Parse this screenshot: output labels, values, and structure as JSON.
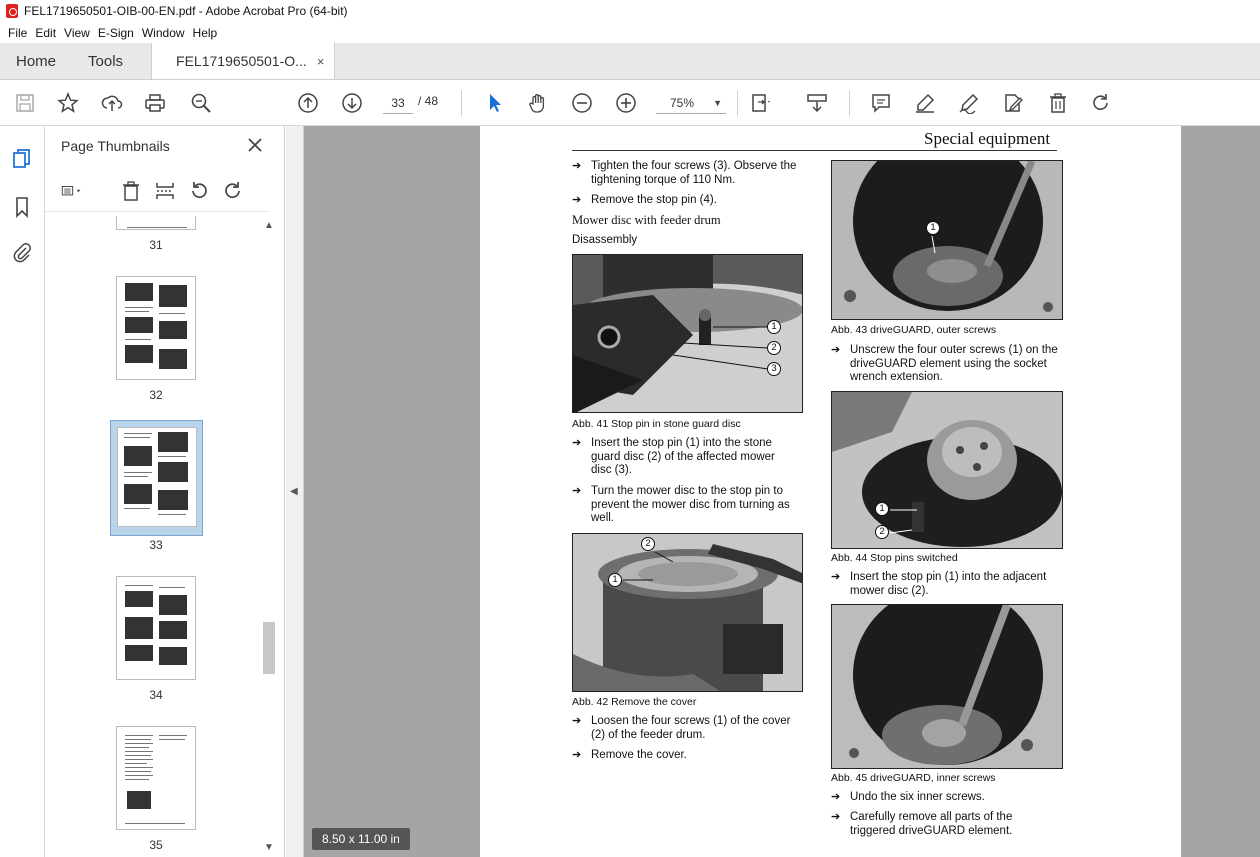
{
  "window": {
    "title": "FEL1719650501-OIB-00-EN.pdf - Adobe Acrobat Pro (64-bit)"
  },
  "menu": [
    "File",
    "Edit",
    "View",
    "E-Sign",
    "Window",
    "Help"
  ],
  "tabs": {
    "home": "Home",
    "tools": "Tools",
    "document": "FEL1719650501-O...",
    "close": "×"
  },
  "toolbar": {
    "current_page": "33",
    "total_pages": "/ 48",
    "zoom": "75%"
  },
  "panel": {
    "title": "Page Thumbnails",
    "thumbnails": [
      {
        "label": "31"
      },
      {
        "label": "32"
      },
      {
        "label": "33",
        "selected": true
      },
      {
        "label": "34"
      },
      {
        "label": "35"
      }
    ]
  },
  "status": {
    "page_size": "8.50 x 11.00 in"
  },
  "page": {
    "header": "Special equipment",
    "left_column": {
      "bullet1": "Tighten the four screws (3). Observe the tightening torque of 110 Nm.",
      "bullet2": "Remove the stop pin (4).",
      "section_heading": "Mower disc with feeder drum",
      "sub_heading": "Disassembly",
      "fig41_caption": "Abb. 41   Stop pin in stone guard disc",
      "fig41_callouts": [
        "1",
        "2",
        "3"
      ],
      "bullet3": "Insert the stop pin (1) into the stone guard disc (2) of the affected mower disc (3).",
      "bullet4": "Turn the mower disc to the stop pin to prevent the mower disc from turning as well.",
      "fig42_caption": "Abb. 42   Remove the cover",
      "fig42_callouts": [
        "2",
        "1"
      ],
      "bullet5": "Loosen the four screws (1) of the cover (2) of the feeder drum.",
      "bullet6": "Remove the cover."
    },
    "right_column": {
      "fig43_caption": "Abb. 43   driveGUARD, outer screws",
      "fig43_callouts": [
        "1"
      ],
      "bullet1": "Unscrew the four outer screws (1) on the driveGUARD element using the socket wrench extension.",
      "fig44_caption": "Abb. 44   Stop pins switched",
      "fig44_callouts": [
        "1",
        "2"
      ],
      "bullet2": "Insert the stop pin (1) into the adjacent mower disc (2).",
      "fig45_caption": "Abb. 45   driveGUARD, inner screws",
      "bullet3": "Undo the six inner screws.",
      "bullet4": "Carefully remove all parts of the triggered driveGUARD element."
    }
  },
  "colors": {
    "doc_background": "#a5a5a5",
    "selection": "#b9d3ea",
    "accent_blue": "#1a6fd6",
    "pdf_red": "#e01f1f"
  },
  "icons": {
    "toolbar": [
      "save-icon",
      "star-icon",
      "upload-icon",
      "print-icon",
      "zoom-search-icon",
      "page-up-icon",
      "page-down-icon",
      "select-cursor-icon",
      "hand-icon",
      "zoom-out-icon",
      "zoom-in-icon",
      "fit-page-icon",
      "scroll-mode-icon",
      "comment-icon",
      "highlight-icon",
      "sign-icon",
      "edit-icon",
      "delete-icon",
      "redo-icon"
    ],
    "rail": [
      "pages-icon",
      "bookmark-icon",
      "attachment-icon"
    ],
    "panel": [
      "options-icon",
      "delete-icon",
      "insert-icon",
      "rotate-left-icon",
      "rotate-right-icon",
      "close-icon"
    ]
  }
}
